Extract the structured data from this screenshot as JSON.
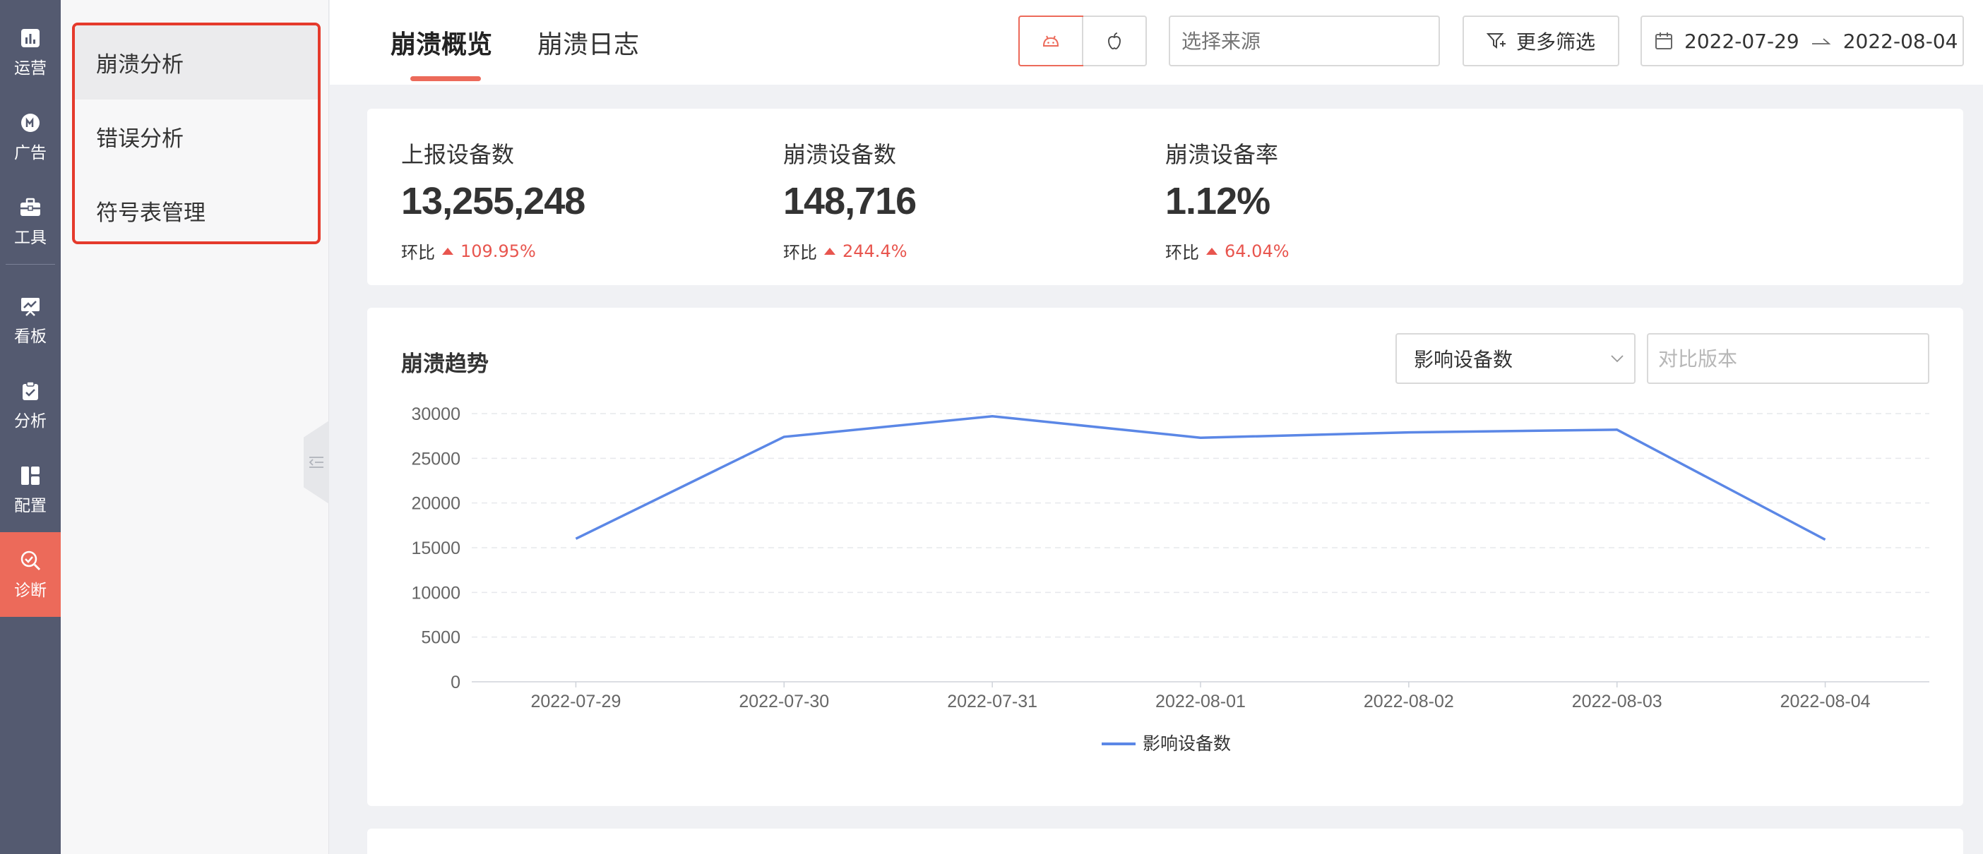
{
  "rail": [
    {
      "label": "运营",
      "icon": "bar-chart-icon"
    },
    {
      "label": "广告",
      "icon": "ad-icon"
    },
    {
      "label": "工具",
      "icon": "toolbox-icon"
    },
    {
      "label": "看板",
      "icon": "dashboard-icon"
    },
    {
      "label": "分析",
      "icon": "clipboard-check-icon"
    },
    {
      "label": "配置",
      "icon": "layout-icon"
    },
    {
      "label": "诊断",
      "icon": "diagnose-icon"
    }
  ],
  "submenu": [
    "崩溃分析",
    "错误分析",
    "符号表管理"
  ],
  "header": {
    "tabs": [
      "崩溃概览",
      "崩溃日志"
    ],
    "source_placeholder": "选择来源",
    "more_filters": "更多筛选",
    "date_start": "2022-07-29",
    "date_end": "2022-08-04"
  },
  "kpis": [
    {
      "label": "上报设备数",
      "value": "13,255,248",
      "compare_label": "环比",
      "compare_value": "109.95%"
    },
    {
      "label": "崩溃设备数",
      "value": "148,716",
      "compare_label": "环比",
      "compare_value": "244.4%"
    },
    {
      "label": "崩溃设备率",
      "value": "1.12%",
      "compare_label": "环比",
      "compare_value": "64.04%"
    }
  ],
  "chart_panel": {
    "title": "崩溃趋势",
    "metric_selected": "影响设备数",
    "compare_placeholder": "对比版本"
  },
  "colors": {
    "accent": "#ec6a5a",
    "rail": "#545a70",
    "line": "#5b87e6",
    "up": "#e8554e"
  },
  "chart_data": {
    "type": "line",
    "x": [
      "2022-07-29",
      "2022-07-30",
      "2022-07-31",
      "2022-08-01",
      "2022-08-02",
      "2022-08-03",
      "2022-08-04"
    ],
    "series": [
      {
        "name": "影响设备数",
        "values": [
          16000,
          27400,
          29700,
          27300,
          27900,
          28200,
          15900
        ]
      }
    ],
    "y_ticks": [
      0,
      5000,
      10000,
      15000,
      20000,
      25000,
      30000
    ],
    "ylim": [
      0,
      30000
    ],
    "grid": true,
    "legend": "bottom-center"
  }
}
